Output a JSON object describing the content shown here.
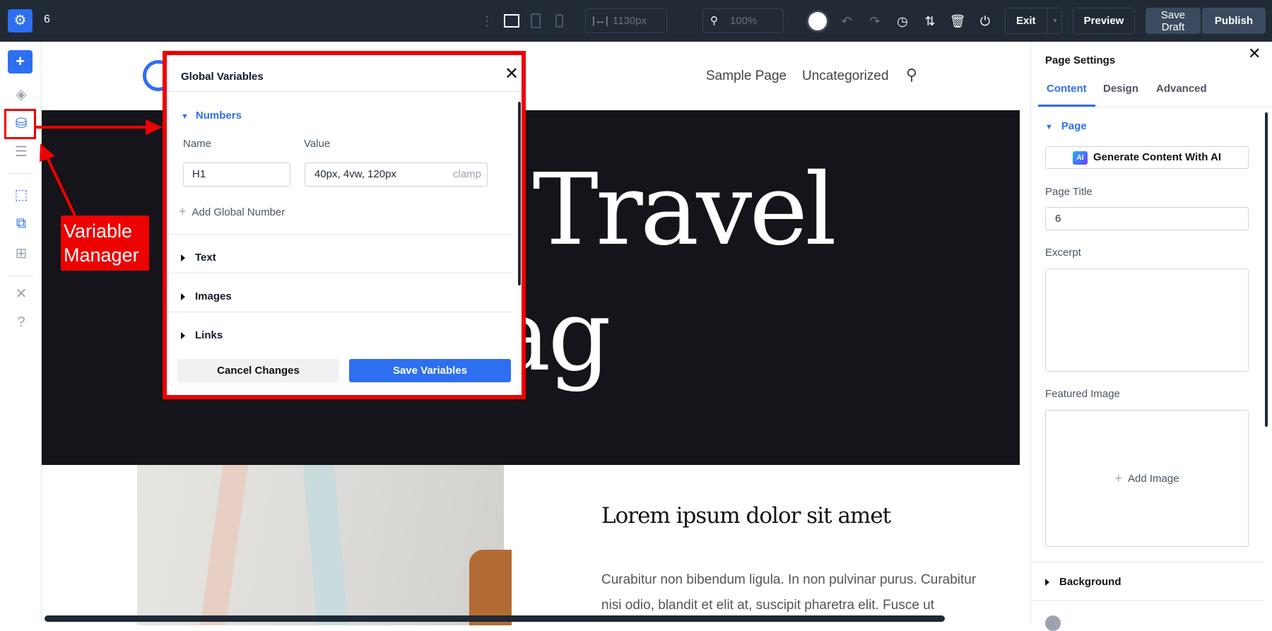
{
  "topbar": {
    "page_name": "6",
    "width_value": "1130px",
    "zoom_value": "100%",
    "exit": "Exit",
    "preview": "Preview",
    "save_draft_1": "Save",
    "save_draft_2": "Draft",
    "publish": "Publish"
  },
  "site": {
    "nav": [
      "Sample Page",
      "Uncategorized"
    ],
    "hero_line1": "Your Travel",
    "hero_line2": "Mag",
    "card_title": "Lorem ipsum dolor sit amet",
    "card_text_1": "Curabitur non bibendum ligula. In non pulvinar purus. Curabitur",
    "card_text_2": "nisi odio, blandit et elit at, suscipit pharetra elit. Fusce ut"
  },
  "annotation": {
    "line1": "Variable",
    "line2": "Manager"
  },
  "dialog": {
    "title": "Global Variables",
    "numbers": "Numbers",
    "name_label": "Name",
    "value_label": "Value",
    "name_value": "H1",
    "value_value": "40px, 4vw, 120px",
    "value_suffix": "clamp",
    "add": "Add Global Number",
    "sections": [
      "Text",
      "Images",
      "Links"
    ],
    "cancel": "Cancel Changes",
    "save": "Save Variables"
  },
  "panel": {
    "title": "Page Settings",
    "tabs": [
      "Content",
      "Design",
      "Advanced"
    ],
    "group": "Page",
    "ai_button": "Generate Content With AI",
    "ai_badge": "AI",
    "page_title_label": "Page Title",
    "page_title_value": "6",
    "excerpt_label": "Excerpt",
    "featured_label": "Featured Image",
    "add_image": "Add Image",
    "background": "Background"
  },
  "colors": {
    "accent": "#2e6ff2",
    "topbar": "#222a35",
    "annotation": "#ee0000",
    "hero": "#14141a"
  }
}
